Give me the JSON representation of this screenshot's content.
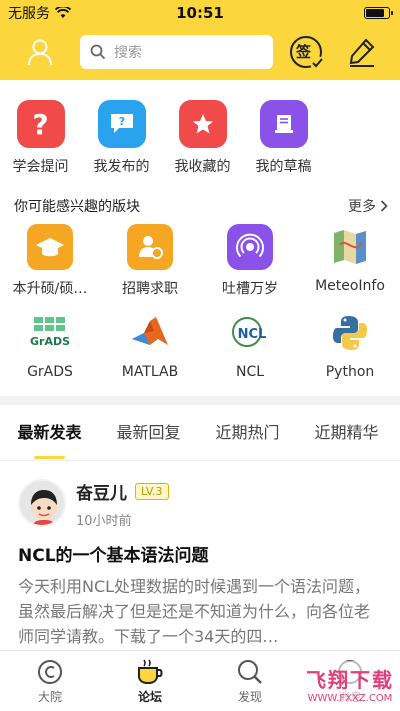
{
  "status_bar": {
    "carrier": "无服务",
    "time": "10:51",
    "battery_level": 0.85
  },
  "header": {
    "search_placeholder": "搜索",
    "sign_label": "签"
  },
  "quick_actions": [
    {
      "label": "学会提问",
      "icon": "question-icon",
      "color": "#f04a4a"
    },
    {
      "label": "我发布的",
      "icon": "chat-icon",
      "color": "#2aa3ef"
    },
    {
      "label": "我收藏的",
      "icon": "star-icon",
      "color": "#f04a4a"
    },
    {
      "label": "我的草稿",
      "icon": "draft-icon",
      "color": "#8a52e8"
    }
  ],
  "boards_section": {
    "title": "你可能感兴趣的版块",
    "more": "更多",
    "boards": [
      {
        "label": "本升硕/硕…",
        "icon": "graduation-cap-icon",
        "color": "#f5a623"
      },
      {
        "label": "招聘求职",
        "icon": "job-icon",
        "color": "#f5a623"
      },
      {
        "label": "吐槽万岁",
        "icon": "broadcast-icon",
        "color": "#8a52e8"
      },
      {
        "label": "MeteoInfo",
        "icon": "map-icon",
        "color": "#7fb36a"
      },
      {
        "label": "GrADS",
        "icon": "grads-icon",
        "color": "#2e9b5a",
        "logo_text": "GrADS"
      },
      {
        "label": "MATLAB",
        "icon": "matlab-icon",
        "color": "#e5681e"
      },
      {
        "label": "NCL",
        "icon": "ncl-icon",
        "color": "#1a5fa8",
        "logo_text": "NCL"
      },
      {
        "label": "Python",
        "icon": "python-icon",
        "color": "#3670a0"
      }
    ]
  },
  "tabs": [
    {
      "label": "最新发表",
      "active": true
    },
    {
      "label": "最新回复",
      "active": false
    },
    {
      "label": "近期热门",
      "active": false
    },
    {
      "label": "近期精华",
      "active": false
    }
  ],
  "post": {
    "author": "奋豆儿",
    "level": "LV.3",
    "time": "10小时前",
    "title": "NCL的一个基本语法问题",
    "body": "今天利用NCL处理数据的时候遇到一个语法问题，虽然最后解决了但是还是不知道为什么，向各位老师同学请教。下载了一个34天的四…"
  },
  "tabbar": [
    {
      "label": "大院",
      "icon": "home-icon",
      "active": false
    },
    {
      "label": "论坛",
      "icon": "coffee-icon",
      "active": true
    },
    {
      "label": "发现",
      "icon": "discover-icon",
      "active": false
    },
    {
      "label": "消息",
      "icon": "message-icon",
      "active": false
    }
  ],
  "watermark": {
    "title": "飞翔下载",
    "url": "WWW.FXXZ.COM"
  }
}
